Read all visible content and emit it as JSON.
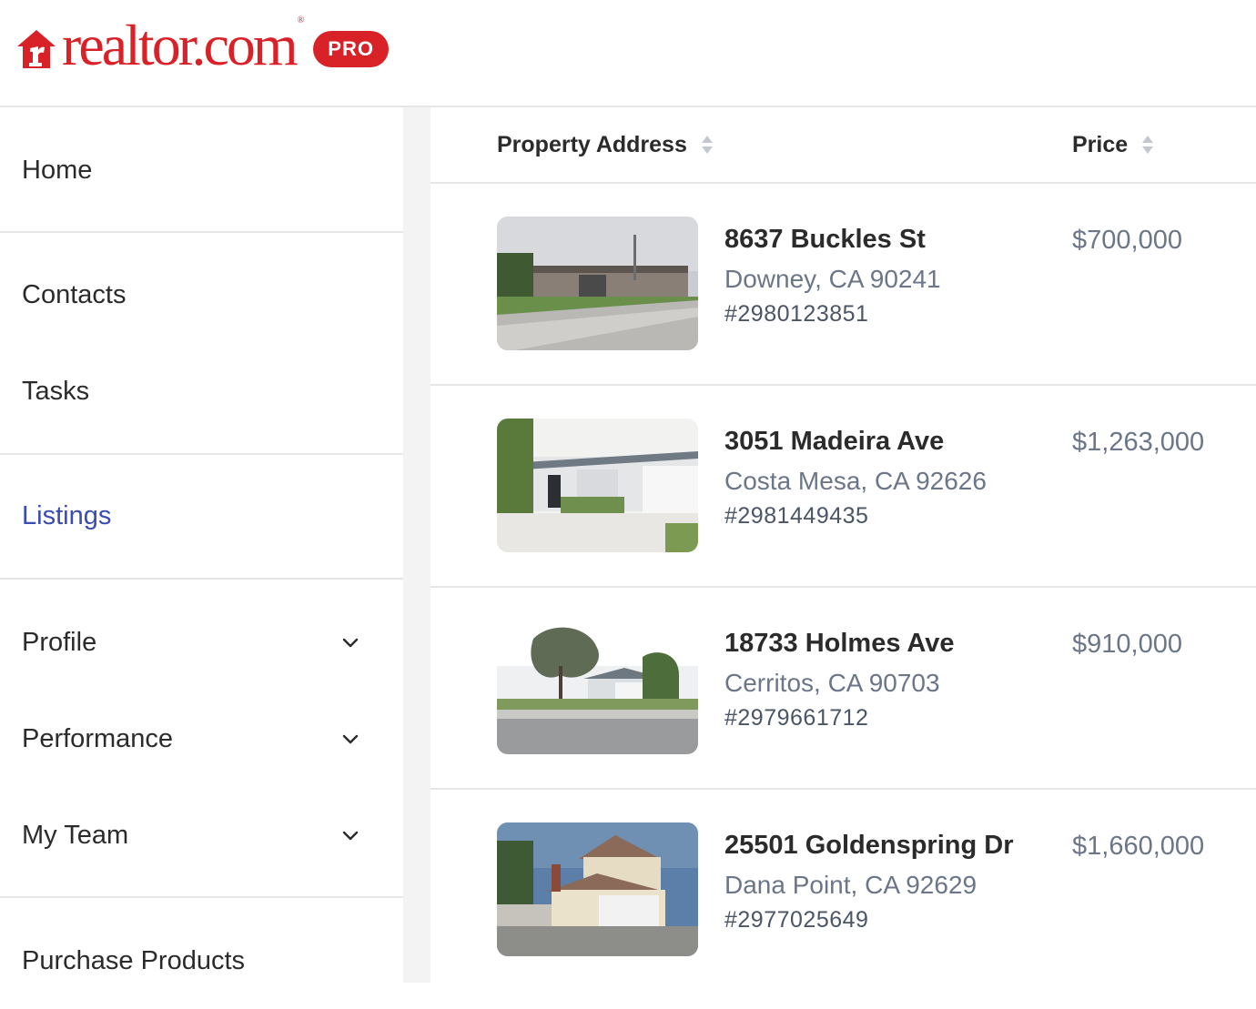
{
  "brand": {
    "wordmark": "realtor.com",
    "reg_mark": "®",
    "badge": "PRO",
    "color": "#d92228"
  },
  "sidebar": {
    "items": [
      {
        "label": "Home"
      },
      {
        "label": "Contacts"
      },
      {
        "label": "Tasks"
      },
      {
        "label": "Listings",
        "active": true
      },
      {
        "label": "Profile",
        "icon": "chevron-down-icon"
      },
      {
        "label": "Performance",
        "icon": "chevron-down-icon"
      },
      {
        "label": "My Team",
        "icon": "chevron-down-icon"
      },
      {
        "label": "Purchase Products"
      }
    ],
    "active_color": "#3a4bb3"
  },
  "table": {
    "columns": [
      {
        "label": "Property Address",
        "icon": "sort-icon"
      },
      {
        "label": "Price",
        "icon": "sort-icon"
      }
    ],
    "rows": [
      {
        "street": "8637 Buckles St",
        "city": "Downey, CA 90241",
        "mls": "#2980123851",
        "price": "$700,000",
        "photo": "house-photo"
      },
      {
        "street": "3051 Madeira Ave",
        "city": "Costa Mesa, CA 92626",
        "mls": "#2981449435",
        "price": "$1,263,000",
        "photo": "house-photo"
      },
      {
        "street": "18733 Holmes Ave",
        "city": "Cerritos, CA 90703",
        "mls": "#2979661712",
        "price": "$910,000",
        "photo": "house-photo"
      },
      {
        "street": "25501 Goldenspring Dr",
        "city": "Dana Point, CA 92629",
        "mls": "#2977025649",
        "price": "$1,660,000",
        "photo": "house-photo"
      }
    ]
  }
}
